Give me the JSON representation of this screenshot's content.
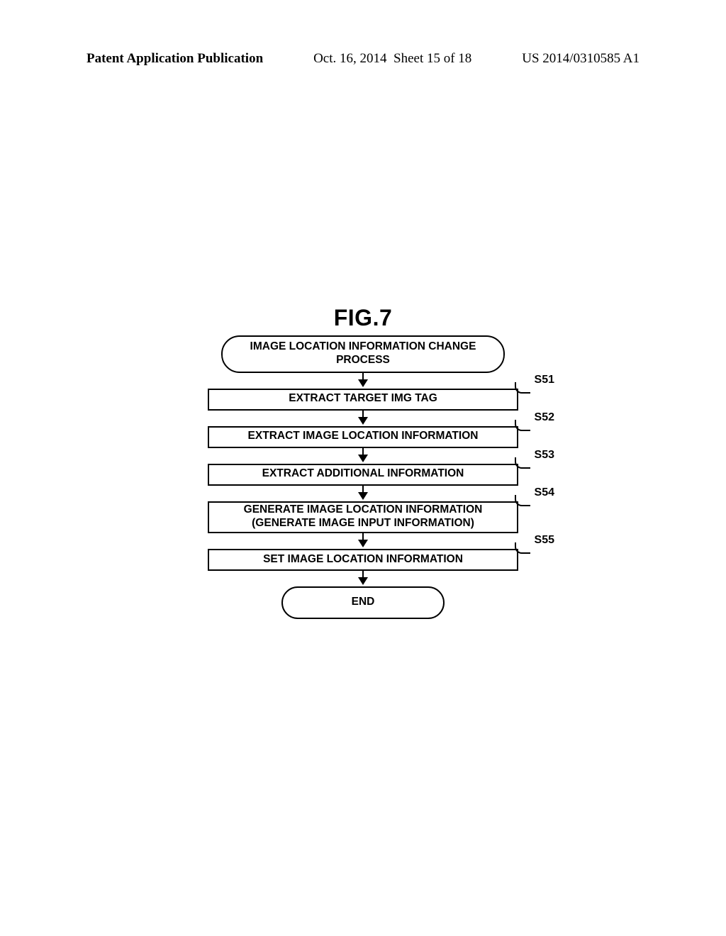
{
  "header": {
    "left": "Patent Application Publication",
    "center_date": "Oct. 16, 2014",
    "center_sheet": "Sheet 15 of 18",
    "right": "US 2014/0310585 A1"
  },
  "figure": {
    "title": "FIG.7",
    "start": "IMAGE LOCATION INFORMATION CHANGE PROCESS",
    "steps": [
      {
        "label": "S51",
        "text_lines": [
          "EXTRACT TARGET IMG TAG"
        ]
      },
      {
        "label": "S52",
        "text_lines": [
          "EXTRACT IMAGE LOCATION INFORMATION"
        ]
      },
      {
        "label": "S53",
        "text_lines": [
          "EXTRACT ADDITIONAL INFORMATION"
        ]
      },
      {
        "label": "S54",
        "text_lines": [
          "GENERATE IMAGE LOCATION INFORMATION",
          "(GENERATE IMAGE INPUT INFORMATION)"
        ]
      },
      {
        "label": "S55",
        "text_lines": [
          "SET IMAGE LOCATION INFORMATION"
        ]
      }
    ],
    "end": "END"
  }
}
